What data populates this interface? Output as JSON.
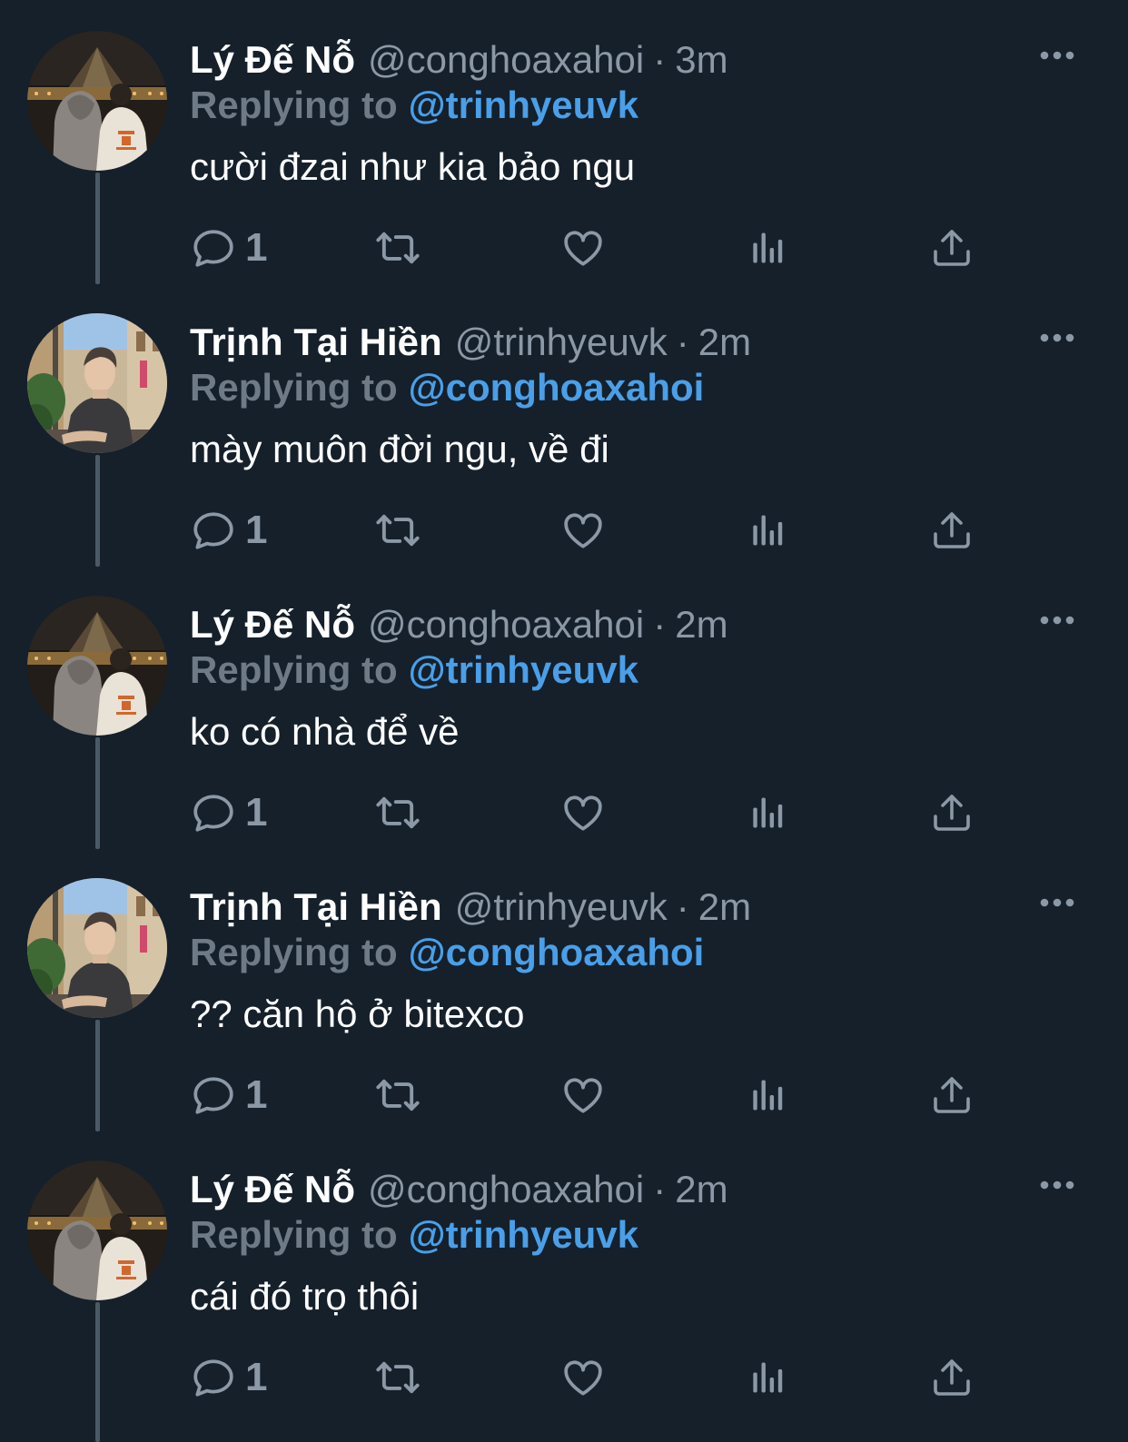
{
  "colors": {
    "background": "#15202b",
    "text": "#ffffff",
    "muted": "#8b98a5",
    "reply_prefix": "#6e7b87",
    "link": "#4a9fe8",
    "thread_line": "#4b5966"
  },
  "tweets": [
    {
      "display_name": "Lý Đế Nỗ",
      "handle": "@conghoaxahoi",
      "separator": "·",
      "time": "3m",
      "reply_prefix": "Replying to",
      "reply_to": "@trinhyeuvk",
      "text": "cười đzai như kia bảo ngu",
      "reply_count": "1",
      "avatar": "avatar-two-people-night",
      "icons": [
        "reply-icon",
        "retweet-icon",
        "like-icon",
        "analytics-icon",
        "share-icon",
        "more-icon"
      ]
    },
    {
      "display_name": "Trịnh Tại Hiền",
      "handle": "@trinhyeuvk",
      "separator": "·",
      "time": "2m",
      "reply_prefix": "Replying to",
      "reply_to": "@conghoaxahoi",
      "text": "mày muôn đời ngu, về đi",
      "reply_count": "1",
      "avatar": "avatar-man-street",
      "icons": [
        "reply-icon",
        "retweet-icon",
        "like-icon",
        "analytics-icon",
        "share-icon",
        "more-icon"
      ]
    },
    {
      "display_name": "Lý Đế Nỗ",
      "handle": "@conghoaxahoi",
      "separator": "·",
      "time": "2m",
      "reply_prefix": "Replying to",
      "reply_to": "@trinhyeuvk",
      "text": "ko có nhà để về",
      "reply_count": "1",
      "avatar": "avatar-two-people-night",
      "icons": [
        "reply-icon",
        "retweet-icon",
        "like-icon",
        "analytics-icon",
        "share-icon",
        "more-icon"
      ]
    },
    {
      "display_name": "Trịnh Tại Hiền",
      "handle": "@trinhyeuvk",
      "separator": "·",
      "time": "2m",
      "reply_prefix": "Replying to",
      "reply_to": "@conghoaxahoi",
      "text": "?? căn hộ ở bitexco",
      "reply_count": "1",
      "avatar": "avatar-man-street",
      "icons": [
        "reply-icon",
        "retweet-icon",
        "like-icon",
        "analytics-icon",
        "share-icon",
        "more-icon"
      ]
    },
    {
      "display_name": "Lý Đế Nỗ",
      "handle": "@conghoaxahoi",
      "separator": "·",
      "time": "2m",
      "reply_prefix": "Replying to",
      "reply_to": "@trinhyeuvk",
      "text": "cái đó trọ thôi",
      "reply_count": "1",
      "avatar": "avatar-two-people-night",
      "icons": [
        "reply-icon",
        "retweet-icon",
        "like-icon",
        "analytics-icon",
        "share-icon",
        "more-icon"
      ]
    }
  ]
}
